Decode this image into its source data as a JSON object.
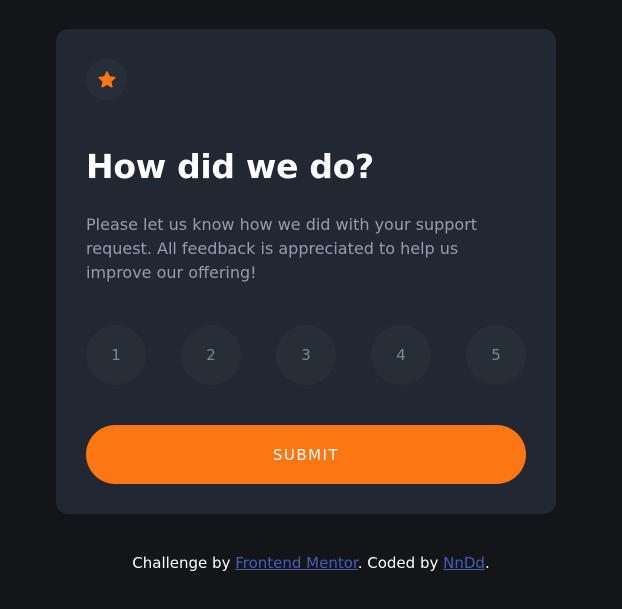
{
  "card": {
    "title": "How did we do?",
    "description": "Please let us know how we did with your support request. All feedback is appreciated to help us improve our offering!",
    "star_icon": "star-icon",
    "ratings": [
      "1",
      "2",
      "3",
      "4",
      "5"
    ],
    "submit_label": "SUBMIT"
  },
  "footer": {
    "prefix": "Challenge by ",
    "mentor_link": "Frontend Mentor",
    "middle": ". Coded by ",
    "author_link": "NnDd",
    "suffix": "."
  },
  "colors": {
    "page_background": "#131518",
    "card_background": "#212733",
    "accent": "#fc7614",
    "rating_background": "#262f38",
    "link": "#4a5bb8"
  }
}
